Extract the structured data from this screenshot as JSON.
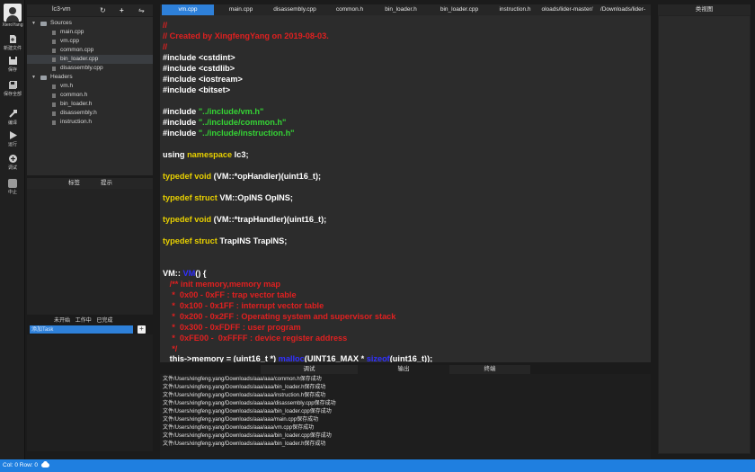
{
  "toolbar": {
    "user_name": "XieroYang",
    "items": [
      {
        "label": "新建文件",
        "icon": "new-file-icon"
      },
      {
        "label": "保存",
        "icon": "save-icon"
      },
      {
        "label": "保存全部",
        "icon": "save-all-icon"
      },
      {
        "label": "编译",
        "icon": "compile-icon"
      },
      {
        "label": "运行",
        "icon": "run-icon"
      },
      {
        "label": "调试",
        "icon": "debug-icon"
      },
      {
        "label": "中止",
        "icon": "stop-icon"
      }
    ]
  },
  "project": {
    "title": "lc3-vm",
    "refresh_icon": "↻",
    "add_icon": "+",
    "toggle_icon": "⇋",
    "sources_label": "Sources",
    "sources": [
      "main.cpp",
      "vm.cpp",
      "common.cpp",
      "bin_loader.cpp",
      "disassembly.cpp"
    ],
    "headers_label": "Headers",
    "headers": [
      "vm.h",
      "common.h",
      "bin_loader.h",
      "disassembly.h",
      "instruction.h"
    ],
    "selected": "bin_loader.cpp"
  },
  "bookmark": {
    "tab_labels": "标签",
    "tab_hints": "提示"
  },
  "task": {
    "tab_todo": "未开始",
    "tab_doing": "工作中",
    "tab_done": "已完成",
    "input_placeholder": "添加Task",
    "add_label": "+"
  },
  "editor": {
    "tabs": [
      "vm.cpp",
      "main.cpp",
      "disassembly.cpp",
      "common.h",
      "bin_loader.h",
      "bin_loader.cpp",
      "instruction.h",
      "oloads/lider-master/",
      "/Downloads/lider-"
    ],
    "active_tab": "vm.cpp",
    "code": {
      "l1": "//",
      "l2": "// Created by XingfengYang on 2019-08-03.",
      "l3": "//",
      "l4": "#include <cstdint>",
      "l5": "#include <cstdlib>",
      "l6": "#include <iostream>",
      "l7": "#include <bitset>",
      "l8_kw": "#include ",
      "l8_str": "\"../include/vm.h\"",
      "l9_kw": "#include ",
      "l9_str": "\"../include/common.h\"",
      "l10_kw": "#include ",
      "l10_str": "\"../include/instruction.h\"",
      "l11_a": "using ",
      "l11_b": "namespace",
      "l11_c": " lc3;",
      "l12_a": "typedef void",
      "l12_b": " (VM::*opHandler)(uint16_t);",
      "l13_a": "typedef struct",
      "l13_b": " VM::OpINS OpINS;",
      "l14_a": "typedef void",
      "l14_b": " (VM::*trapHandler)(uint16_t);",
      "l15_a": "typedef struct",
      "l15_b": " TrapINS TrapINS;",
      "l16_a": "VM:: ",
      "l16_b": "VM",
      "l16_c": "() {",
      "l17": "   /** init memory,memory map",
      "l18": "    *  0x00 - 0xFF : trap vector table",
      "l19": "    *  0x100 - 0x1FF : interrupt vector table",
      "l20": "    *  0x200 - 0x2FF : Operating system and supervisor stack",
      "l21": "    *  0x300 - 0xFDFF : user program",
      "l22": "    *  0xFE00 -  0xFFFF : device register address",
      "l23": "    */",
      "l24_a": "   this->memory = (uint16_t *) ",
      "l24_b": "malloc",
      "l24_c": "(UINT16_MAX * ",
      "l24_d": "sizeof",
      "l24_e": "(uint16_t));"
    }
  },
  "bottom": {
    "tab_debug": "调试",
    "tab_output": "输出",
    "tab_terminal": "终端",
    "log": [
      "文件/Users/xingfeng.yang/Downloads/aaa/aaa/common.h保存成功",
      "文件/Users/xingfeng.yang/Downloads/aaa/aaa/bin_loader.h保存成功",
      "文件/Users/xingfeng.yang/Downloads/aaa/aaa/instruction.h保存成功",
      "文件/Users/xingfeng.yang/Downloads/aaa/aaa/disassembly.cpp保存成功",
      "文件/Users/xingfeng.yang/Downloads/aaa/aaa/bin_loader.cpp保存成功",
      "文件/Users/xingfeng.yang/Downloads/aaa/aaa/main.cpp保存成功",
      "文件/Users/xingfeng.yang/Downloads/aaa/aaa/vm.cpp保存成功",
      "文件/Users/xingfeng.yang/Downloads/aaa/aaa/bin_loader.cpp保存成功",
      "文件/Users/xingfeng.yang/Downloads/aaa/aaa/bin_loader.h保存成功"
    ]
  },
  "classview": {
    "title": "类视图"
  },
  "status": {
    "position": "Col: 0 Row: 0"
  },
  "colors": {
    "accent": "#2e80d9",
    "status_bar": "#1f7fe0",
    "comment": "#e02020",
    "string": "#35d335",
    "keyword": "#e8d000",
    "function": "#3030ff"
  }
}
